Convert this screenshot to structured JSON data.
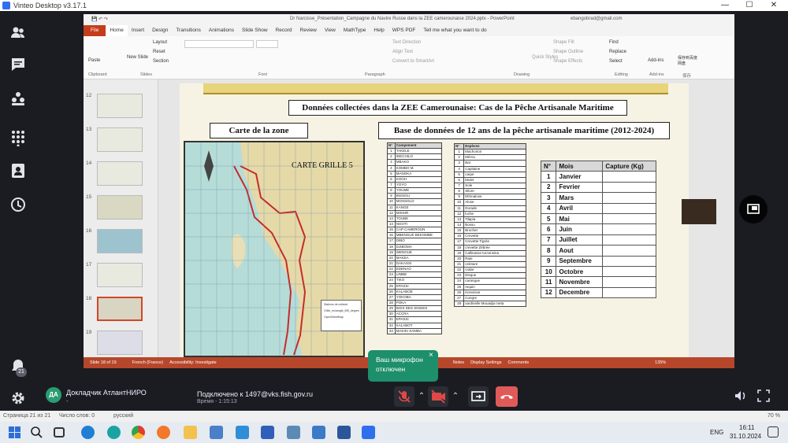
{
  "window": {
    "title": "Vinteo Desktop v3.17.1",
    "minimize": "—",
    "maximize": "☐",
    "close": "✕"
  },
  "ppt": {
    "doc_title": "Dr Narcisse_Présentation_Campagne du Navire Russe dans la ZEE camerounaise 2024.pptx - PowerPoint",
    "user": "ebangobrad@gmail.com",
    "tabs": [
      "File",
      "Home",
      "Insert",
      "Design",
      "Transitions",
      "Animations",
      "Slide Show",
      "Record",
      "Review",
      "View",
      "MathType",
      "Help",
      "WPS PDF",
      "Tell me what you want to do"
    ],
    "ribbon": {
      "paste": "Paste",
      "new_slide": "New Slide",
      "layout": "Layout",
      "reset": "Reset",
      "section": "Section",
      "text_direction": "Text Direction",
      "align_text": "Align Text",
      "convert_smartart": "Convert to SmartArt",
      "quick_styles": "Quick Styles",
      "shape_fill": "Shape Fill",
      "shape_outline": "Shape Outline",
      "shape_effects": "Shape Effects",
      "find": "Find",
      "replace": "Replace",
      "select": "Select",
      "addins": "Add-ins",
      "save_baidu": "保存到百度网盘",
      "groups": [
        "Clipboard",
        "Slides",
        "Font",
        "Paragraph",
        "Drawing",
        "Editing",
        "Add-ins",
        "保存"
      ]
    },
    "thumb_numbers": [
      "12",
      "13",
      "14",
      "15",
      "16",
      "17",
      "18",
      "19"
    ],
    "status": {
      "slide": "Slide 18 of 19",
      "lang": "French (France)",
      "accessibility": "Accessibility: Investigate",
      "notes": "Notes",
      "display": "Display Settings",
      "comments": "Comments",
      "zoom": "135%"
    }
  },
  "slide": {
    "main_title": "Données collectées dans la ZEE  Camerounaise: Cas de la Pêche Artisanale Maritime",
    "map_heading": "Carte de la zone",
    "db_heading": "Base de données de 12 ans de la pêche artisanale maritime (2012-2024)",
    "map_label": "CARTE  GRILLE 5",
    "map_legend": [
      "Stations de collecte",
      "Grille_rectangle_BIS_degres",
      "OpenStreetMap"
    ],
    "camps_header": [
      "N°",
      "Campement"
    ],
    "camps": [
      [
        "1",
        "TAKELE"
      ],
      [
        "2",
        "IDECHILO"
      ],
      [
        "3",
        "MBAKO"
      ],
      [
        "4",
        "KOMBO M."
      ],
      [
        "5",
        "MANOKA"
      ],
      [
        "6",
        "KOOH"
      ],
      [
        "7",
        "YOYO"
      ],
      [
        "8",
        "YOUME"
      ],
      [
        "9",
        "BISSOLI"
      ],
      [
        "10",
        "MOSSOLO"
      ],
      [
        "11",
        "KANGE"
      ],
      [
        "12",
        "MISSIR"
      ],
      [
        "13",
        "TOUBE"
      ],
      [
        "14",
        "NGOTI"
      ],
      [
        "15",
        "CAP CAMEROUN"
      ],
      [
        "16",
        "MBENGUE BEKOMBE"
      ],
      [
        "17",
        "DIBO"
      ],
      [
        "18",
        "DJIBOMA"
      ],
      [
        "19",
        "WENGUE"
      ],
      [
        "20",
        "MAKEA"
      ],
      [
        "21",
        "DAKASSI"
      ],
      [
        "22",
        "EDENAO"
      ],
      [
        "23",
        "LIMBE"
      ],
      [
        "24",
        "TIKO"
      ],
      [
        "25",
        "EPASSI"
      ],
      [
        "26",
        "KALABOE"
      ],
      [
        "27",
        "YOKOBA"
      ],
      [
        "28",
        "POKA"
      ],
      [
        "29",
        "BOIS DES SINGES"
      ],
      [
        "30",
        "ACCRA"
      ],
      [
        "31",
        "EPASSI"
      ],
      [
        "32",
        "KALABOT"
      ],
      [
        "33",
        "MAKIKI SAMBA"
      ]
    ],
    "species_header": [
      "N°",
      "Espèces"
    ],
    "species": [
      [
        "1",
        "Machoiron"
      ],
      [
        "2",
        "Mérou"
      ],
      [
        "3",
        "Bar"
      ],
      [
        "4",
        "Capitaine"
      ],
      [
        "5",
        "carpe"
      ],
      [
        "6",
        "Mulet"
      ],
      [
        "7",
        "Sole"
      ],
      [
        "8",
        "Silure"
      ],
      [
        "9",
        "Ethmalose"
      ],
      [
        "10",
        "Alose"
      ],
      [
        "11",
        "Dorade"
      ],
      [
        "12",
        "loche"
      ],
      [
        "13",
        "Tilapia"
      ],
      [
        "14",
        "Bossu"
      ],
      [
        "15",
        "Brochet"
      ],
      [
        "16",
        "Crevette"
      ],
      [
        "17",
        "Crevette Tigrée"
      ],
      [
        "18",
        "crevette Zébrée"
      ],
      [
        "19",
        "Callinasse turcensina"
      ],
      [
        "20",
        "Raie"
      ],
      [
        "21",
        "ceinture"
      ],
      [
        "22",
        "crabe"
      ],
      [
        "23",
        "Disque"
      ],
      [
        "24",
        "carangue"
      ],
      [
        "25",
        "requin"
      ],
      [
        "26",
        "écrevisse"
      ],
      [
        "27",
        "Congre"
      ],
      [
        "28",
        "sardinelle Mouadja meta"
      ]
    ],
    "months_header": [
      "N°",
      "Mois",
      "Capture (Kg)"
    ],
    "months": [
      [
        "1",
        "Janvier"
      ],
      [
        "2",
        "Fevrier"
      ],
      [
        "3",
        "Mars"
      ],
      [
        "4",
        "Avril"
      ],
      [
        "5",
        "Mai"
      ],
      [
        "6",
        "Juin"
      ],
      [
        "7",
        "Juillet"
      ],
      [
        "8",
        "Aout"
      ],
      [
        "9",
        "Septembre"
      ],
      [
        "10",
        "Octobre"
      ],
      [
        "11",
        "Novembre"
      ],
      [
        "12",
        "Decembre"
      ]
    ]
  },
  "call": {
    "avatar_initials": "ДА",
    "user_name": "Докладчик АтлантНИРО",
    "user_sub": "-",
    "connected": "Подключено к 1497@vks.fish.gov.ru",
    "time_label": "Время - 1:15:13",
    "mic_tooltip_line1": "Ваш микрофон",
    "mic_tooltip_line2": "отключен",
    "tooltip_close": "×",
    "badge_count": "21"
  },
  "word_status": {
    "page": "Страница 21 из 21",
    "words": "Число слов: 0",
    "lang": "русский",
    "zoom": "70 %"
  },
  "taskbar": {
    "lang": "ENG",
    "time": "16:11",
    "date": "31.10.2024"
  }
}
